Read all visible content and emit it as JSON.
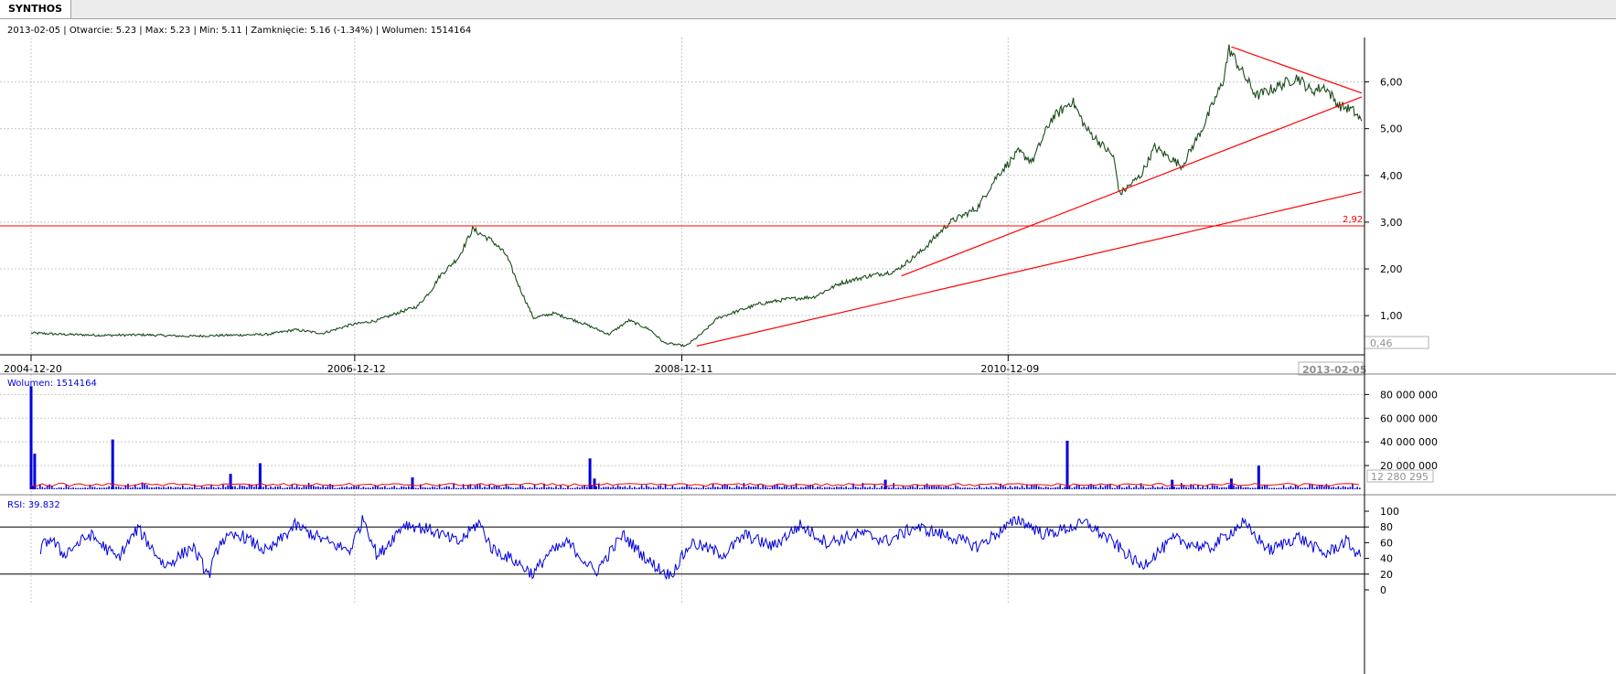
{
  "tab": {
    "label": "SYNTHOS"
  },
  "info_line": "2013-02-05 | Otwarcie: 5.23 | Max: 5.23 | Min: 5.11 | Zamknięcie: 5.16 (-1.34%)  | Wolumen: 1514164",
  "colors": {
    "price": "#1b4d1b",
    "trend": "#ff0000",
    "volume": "#0000dd",
    "volume_ma": "#ff0000",
    "rsi": "#0000dd",
    "grid": "#c8c8c8"
  },
  "chart_data": [
    {
      "type": "line",
      "panel": "price",
      "x_tick_labels": [
        "2004-12-20",
        "2006-12-12",
        "2008-12-11",
        "2010-12-09"
      ],
      "x_end_label": "2013-02-05",
      "x_range": [
        "2004-12-20",
        "2013-02-05"
      ],
      "y_tick_labels": [
        "1,00",
        "2,00",
        "3,00",
        "4,00",
        "5,00",
        "6,00"
      ],
      "ylim": [
        0.26,
        6.95
      ],
      "grid": true,
      "series": [
        {
          "x": [
            "2004-12-20",
            "2005-03-01",
            "2005-06-01",
            "2005-09-01",
            "2005-12-01",
            "2006-03-01",
            "2006-06-01",
            "2006-08-01",
            "2006-10-01",
            "2006-12-01",
            "2007-02-01",
            "2007-03-15",
            "2007-05-01",
            "2007-06-01",
            "2007-06-20",
            "2007-08-01",
            "2007-09-01",
            "2007-10-15",
            "2007-11-15",
            "2007-12-15",
            "2008-01-15",
            "2008-03-01",
            "2008-05-01",
            "2008-07-01",
            "2008-08-15",
            "2008-10-01",
            "2008-11-01",
            "2008-12-20",
            "2009-01-25",
            "2009-03-01",
            "2009-04-15",
            "2009-06-01",
            "2009-08-01",
            "2009-10-01",
            "2009-12-01",
            "2010-02-01",
            "2010-04-01",
            "2010-06-01",
            "2010-08-01",
            "2010-10-01",
            "2010-11-15",
            "2011-01-01",
            "2011-02-01",
            "2011-03-15",
            "2011-05-01",
            "2011-06-01",
            "2011-08-01",
            "2011-08-15",
            "2011-10-01",
            "2011-11-01",
            "2012-01-01",
            "2012-02-15",
            "2012-04-01",
            "2012-04-15",
            "2012-05-15",
            "2012-06-15",
            "2012-08-01",
            "2012-09-15",
            "2012-10-15",
            "2012-11-15",
            "2012-12-15",
            "2013-01-15",
            "2013-02-05"
          ],
          "y": [
            0.63,
            0.6,
            0.58,
            0.59,
            0.56,
            0.58,
            0.6,
            0.7,
            0.62,
            0.8,
            0.9,
            1.05,
            1.2,
            1.55,
            1.85,
            2.25,
            2.85,
            2.6,
            2.3,
            1.6,
            0.95,
            1.05,
            0.85,
            0.6,
            0.9,
            0.7,
            0.42,
            0.35,
            0.62,
            0.95,
            1.1,
            1.25,
            1.35,
            1.4,
            1.7,
            1.85,
            1.95,
            2.4,
            3.0,
            3.3,
            4.0,
            4.5,
            4.3,
            5.2,
            5.6,
            5.0,
            4.4,
            3.6,
            4.0,
            4.6,
            4.2,
            5.0,
            6.0,
            6.7,
            6.2,
            5.7,
            5.9,
            6.1,
            5.8,
            5.9,
            5.5,
            5.4,
            5.16
          ]
        }
      ],
      "annotations": [
        {
          "type": "hline",
          "value": 2.92,
          "label": "2,92"
        },
        {
          "type": "trendline",
          "from": [
            "2009-01-13",
            0.35
          ],
          "to": [
            "2013-02-05",
            3.65
          ]
        },
        {
          "type": "trendline",
          "from": [
            "2010-04-15",
            1.85
          ],
          "to": [
            "2013-02-05",
            5.68
          ]
        },
        {
          "type": "trendline",
          "from": [
            "2012-04-20",
            6.75
          ],
          "to": [
            "2013-02-05",
            5.76
          ]
        }
      ],
      "y_marker_label": "0,46"
    },
    {
      "type": "bar",
      "panel": "volume",
      "title": "Wolumen: 1514164",
      "y_tick_labels": [
        "20 000 000",
        "40 000 000",
        "60 000 000",
        "80 000 000"
      ],
      "ylim": [
        0,
        88000000
      ],
      "y_marker_label": "12 280 295",
      "spikes": {
        "dates": [
          "2004-12-20",
          "2004-12-28",
          "2005-06-20",
          "2006-03-10",
          "2006-05-15",
          "2007-04-20",
          "2008-05-20",
          "2008-05-30",
          "2010-03-10",
          "2011-04-20",
          "2011-12-10",
          "2012-04-20",
          "2012-06-20"
        ],
        "values": [
          87000000,
          30000000,
          42000000,
          13000000,
          22000000,
          10000000,
          26000000,
          9000000,
          8000000,
          41000000,
          8000000,
          9000000,
          20000000
        ]
      },
      "typical_daily_range": [
        1000000,
        6000000
      ]
    },
    {
      "type": "line",
      "panel": "rsi",
      "title": "RSI: 39.832",
      "y_tick_labels": [
        "0",
        "20",
        "40",
        "60",
        "80",
        "100"
      ],
      "ylim": [
        0,
        100
      ],
      "reference_lines": [
        20,
        80
      ],
      "series": [
        {
          "x": [
            "2005-01-10",
            "2005-02-01",
            "2005-03-01",
            "2005-05-01",
            "2005-07-01",
            "2005-08-15",
            "2005-10-15",
            "2005-12-15",
            "2006-01-20",
            "2006-02-15",
            "2006-04-01",
            "2006-06-01",
            "2006-08-01",
            "2006-10-15",
            "2006-12-01",
            "2007-01-01",
            "2007-02-01",
            "2007-04-01",
            "2007-06-01",
            "2007-08-01",
            "2007-09-15",
            "2007-10-15",
            "2007-12-01",
            "2008-01-15",
            "2008-02-15",
            "2008-04-01",
            "2008-06-01",
            "2008-08-01",
            "2008-10-01",
            "2008-11-15",
            "2009-01-01",
            "2009-03-15",
            "2009-05-01",
            "2009-07-01",
            "2009-09-01",
            "2009-11-01",
            "2010-01-15",
            "2010-03-15",
            "2010-05-15",
            "2010-08-01",
            "2010-10-01",
            "2011-01-01",
            "2011-03-01",
            "2011-06-01",
            "2011-08-01",
            "2011-10-01",
            "2011-12-15",
            "2012-03-01",
            "2012-05-15",
            "2012-07-15",
            "2012-09-15",
            "2012-11-15",
            "2013-01-01",
            "2013-02-05"
          ],
          "y": [
            52,
            66,
            45,
            70,
            40,
            78,
            30,
            55,
            18,
            62,
            70,
            48,
            82,
            60,
            50,
            92,
            42,
            84,
            76,
            60,
            86,
            52,
            38,
            20,
            45,
            60,
            22,
            70,
            35,
            18,
            60,
            45,
            70,
            55,
            82,
            60,
            72,
            62,
            80,
            68,
            55,
            90,
            70,
            85,
            60,
            30,
            65,
            52,
            85,
            50,
            68,
            45,
            62,
            40
          ]
        }
      ]
    }
  ]
}
